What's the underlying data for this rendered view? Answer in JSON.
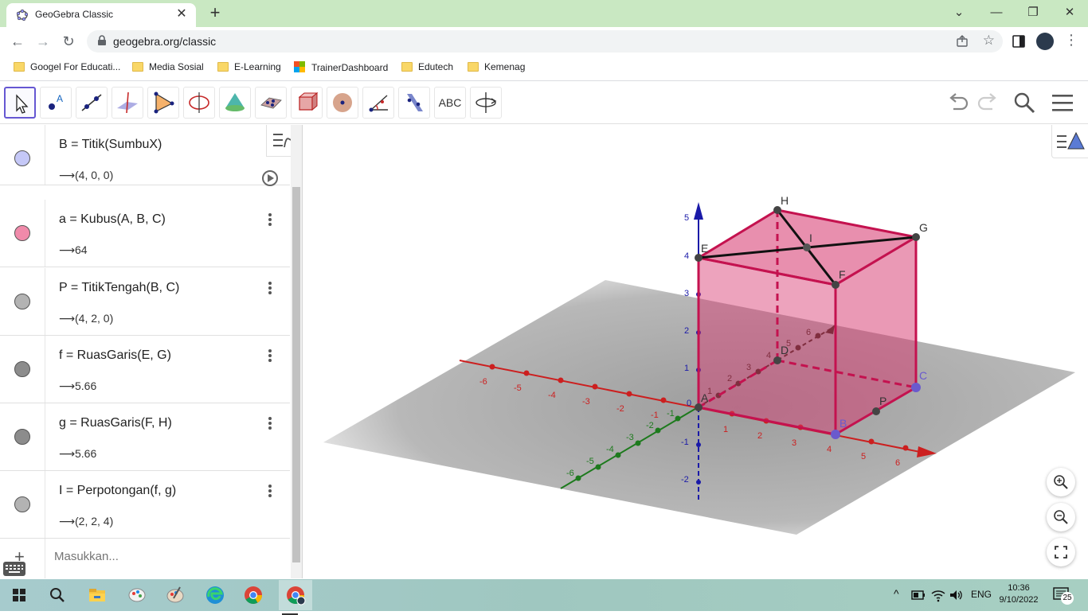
{
  "browser": {
    "tab_title": "GeoGebra Classic",
    "url": "geogebra.org/classic",
    "bookmarks": [
      "Googel For Educati...",
      "Media Sosial",
      "E-Learning",
      "TrainerDashboard",
      "Edutech",
      "Kemenag"
    ]
  },
  "toolbar": {
    "tools": [
      "move",
      "point",
      "line",
      "perpendicular-line",
      "polygon",
      "circle-with-axis",
      "pyramid",
      "plane",
      "net",
      "sphere",
      "angle",
      "reflect",
      "text",
      "rotate-view"
    ],
    "text_tool_label": "ABC"
  },
  "algebra": {
    "rows": [
      {
        "definition": "B = Titik(SumbuX)",
        "value": "(4, 0, 0)",
        "color": "#c5c8f7"
      },
      {
        "definition": "a = Kubus(A, B, C)",
        "value": "64",
        "color": "#f08aaa"
      },
      {
        "definition": "P = TitikTengah(B, C)",
        "value": "(4, 2, 0)",
        "color": "#b3b3b3"
      },
      {
        "definition": "f = RuasGaris(E, G)",
        "value": "5.66",
        "color": "#8c8c8c"
      },
      {
        "definition": "g = RuasGaris(F, H)",
        "value": "5.66",
        "color": "#8c8c8c"
      },
      {
        "definition": "I = Perpotongan(f, g)",
        "value": "(2, 2, 4)",
        "color": "#b3b3b3"
      }
    ],
    "arrow": "⟶",
    "input_placeholder": "Masukkan..."
  },
  "graphics": {
    "points": [
      "A",
      "B",
      "C",
      "D",
      "E",
      "F",
      "G",
      "H",
      "I",
      "P"
    ],
    "x_ticks": [
      "-6",
      "-5",
      "-4",
      "-3",
      "-2",
      "-1",
      "1",
      "2",
      "3",
      "4",
      "5",
      "6"
    ],
    "y_ticks_neg": [
      "-6",
      "-5",
      "-4",
      "-3",
      "-2",
      "-1"
    ],
    "y_ticks_pos": [
      "1",
      "2",
      "3",
      "4",
      "5",
      "6"
    ],
    "z_ticks": [
      "5",
      "4",
      "3",
      "2",
      "1",
      "0",
      "-1",
      "-2"
    ],
    "origin_label": "0",
    "colors": {
      "cube": "#d6336c",
      "x_axis": "#cc1f1f",
      "y_axis": "#1d7a1d",
      "z_axis": "#1a1aa8",
      "segment": "#111111"
    }
  },
  "taskbar": {
    "lang": "ENG",
    "time": "10:36",
    "date": "9/10/2022",
    "notifications": "25"
  }
}
